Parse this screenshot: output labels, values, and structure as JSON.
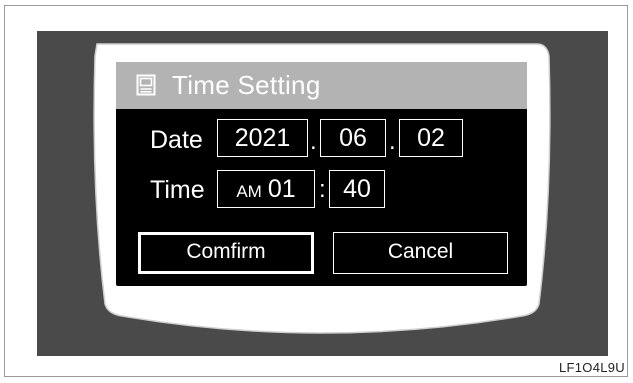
{
  "dialog": {
    "title": "Time Setting",
    "title_icon": "display-panel-icon"
  },
  "date": {
    "label": "Date",
    "year": "2021",
    "month": "06",
    "day": "02",
    "separator": "."
  },
  "time": {
    "label": "Time",
    "period": "AM",
    "hour": "01",
    "minute": "40",
    "separator": ":"
  },
  "buttons": {
    "confirm_label": "Comfirm",
    "cancel_label": "Cancel"
  },
  "figure_code": "LF1O4L9U",
  "colors": {
    "screen_background": "#000000",
    "title_bar": "#b3b3b3",
    "outer_band": "#4a4a4a",
    "bezel": "#ffffff"
  }
}
